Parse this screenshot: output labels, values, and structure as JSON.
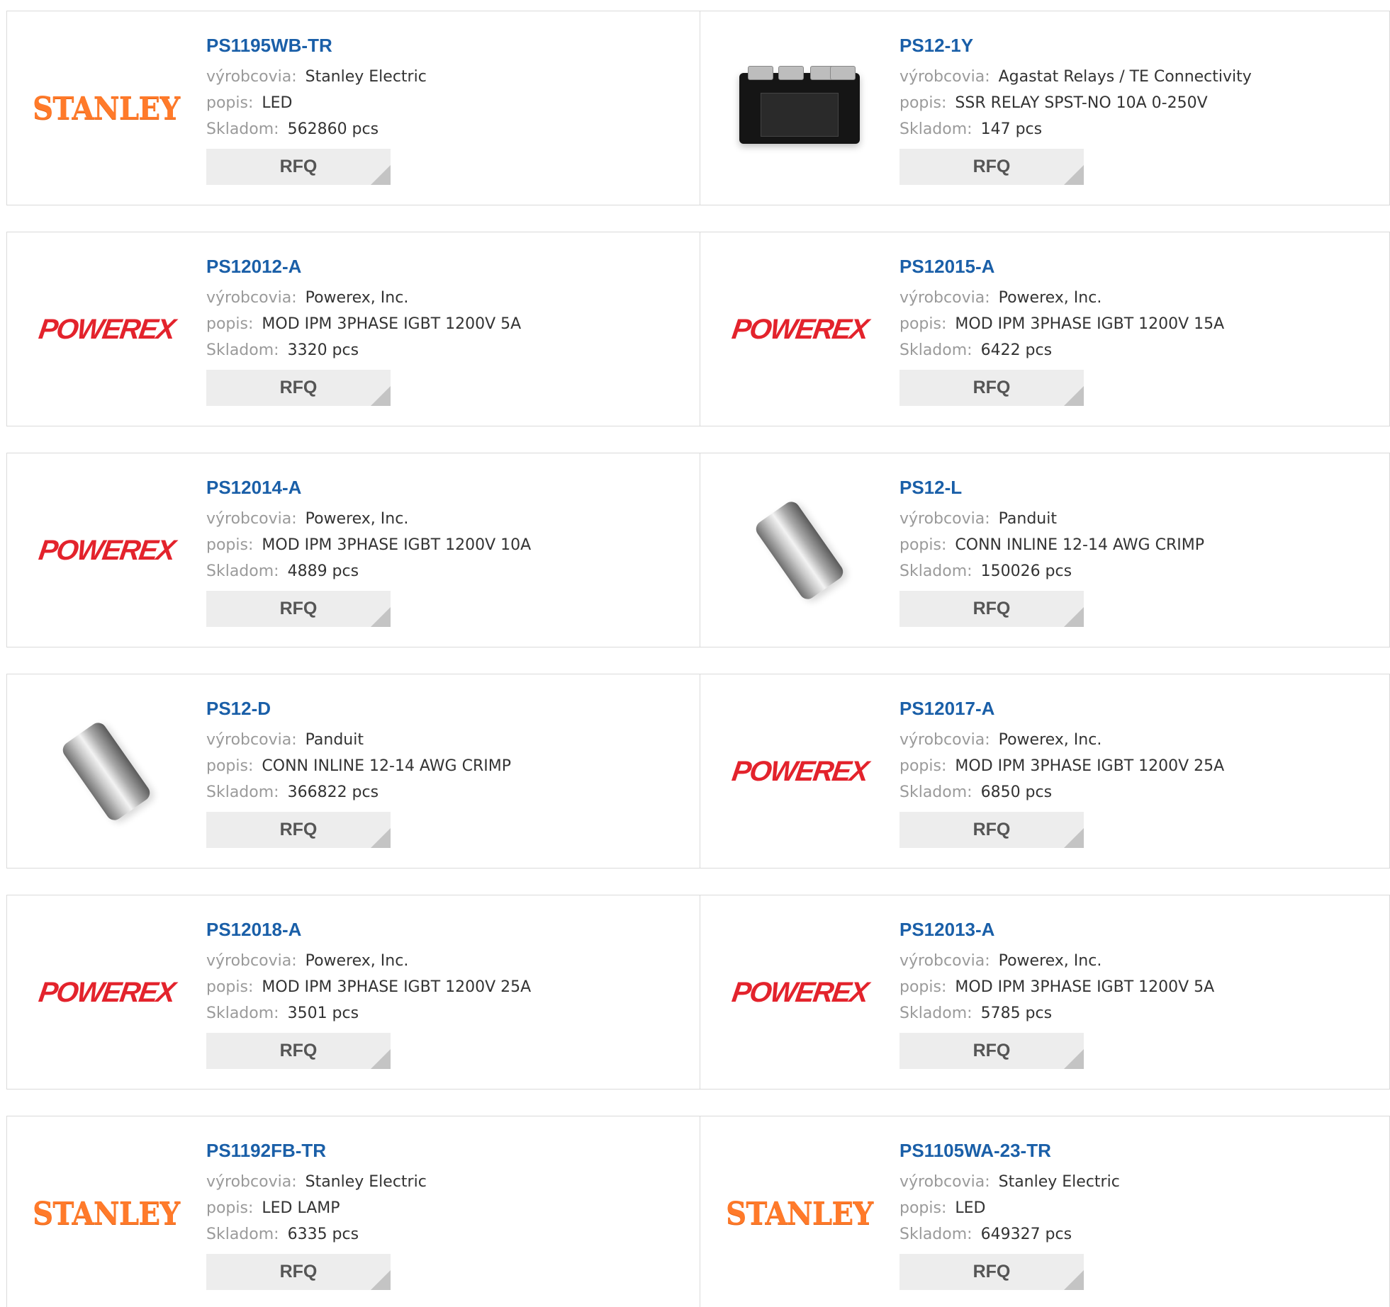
{
  "labels": {
    "manufacturer": "výrobcovia:",
    "description": "popis:",
    "stock": "Skladom:",
    "rfq": "RFQ"
  },
  "products": [
    {
      "part": "PS1195WB-TR",
      "manufacturer": "Stanley Electric",
      "description": "LED",
      "stock": "562860 pcs",
      "image": "stanley-logo"
    },
    {
      "part": "PS12-1Y",
      "manufacturer": "Agastat Relays / TE Connectivity",
      "description": "SSR RELAY SPST-NO 10A 0-250V",
      "stock": "147 pcs",
      "image": "relay-photo"
    },
    {
      "part": "PS12012-A",
      "manufacturer": "Powerex, Inc.",
      "description": "MOD IPM 3PHASE IGBT 1200V 5A",
      "stock": "3320 pcs",
      "image": "powerex-logo"
    },
    {
      "part": "PS12015-A",
      "manufacturer": "Powerex, Inc.",
      "description": "MOD IPM 3PHASE IGBT 1200V 15A",
      "stock": "6422 pcs",
      "image": "powerex-logo"
    },
    {
      "part": "PS12014-A",
      "manufacturer": "Powerex, Inc.",
      "description": "MOD IPM 3PHASE IGBT 1200V 10A",
      "stock": "4889 pcs",
      "image": "powerex-logo"
    },
    {
      "part": "PS12-L",
      "manufacturer": "Panduit",
      "description": "CONN INLINE 12-14 AWG CRIMP",
      "stock": "150026 pcs",
      "image": "connector-photo"
    },
    {
      "part": "PS12-D",
      "manufacturer": "Panduit",
      "description": "CONN INLINE 12-14 AWG CRIMP",
      "stock": "366822 pcs",
      "image": "connector-photo"
    },
    {
      "part": "PS12017-A",
      "manufacturer": "Powerex, Inc.",
      "description": "MOD IPM 3PHASE IGBT 1200V 25A",
      "stock": "6850 pcs",
      "image": "powerex-logo"
    },
    {
      "part": "PS12018-A",
      "manufacturer": "Powerex, Inc.",
      "description": "MOD IPM 3PHASE IGBT 1200V 25A",
      "stock": "3501 pcs",
      "image": "powerex-logo"
    },
    {
      "part": "PS12013-A",
      "manufacturer": "Powerex, Inc.",
      "description": "MOD IPM 3PHASE IGBT 1200V 5A",
      "stock": "5785 pcs",
      "image": "powerex-logo"
    },
    {
      "part": "PS1192FB-TR",
      "manufacturer": "Stanley Electric",
      "description": "LED LAMP",
      "stock": "6335 pcs",
      "image": "stanley-logo"
    },
    {
      "part": "PS1105WA-23-TR",
      "manufacturer": "Stanley Electric",
      "description": "LED",
      "stock": "649327 pcs",
      "image": "stanley-logo"
    }
  ],
  "logos": {
    "stanley": "STANLEY",
    "powerex": "POWEREX"
  },
  "colors": {
    "part_link": "#1a5fa8",
    "label_gray": "#9a9a9a",
    "stanley_orange": "#ff7a2a",
    "powerex_red": "#e3232c",
    "rfq_bg": "#ededed"
  }
}
